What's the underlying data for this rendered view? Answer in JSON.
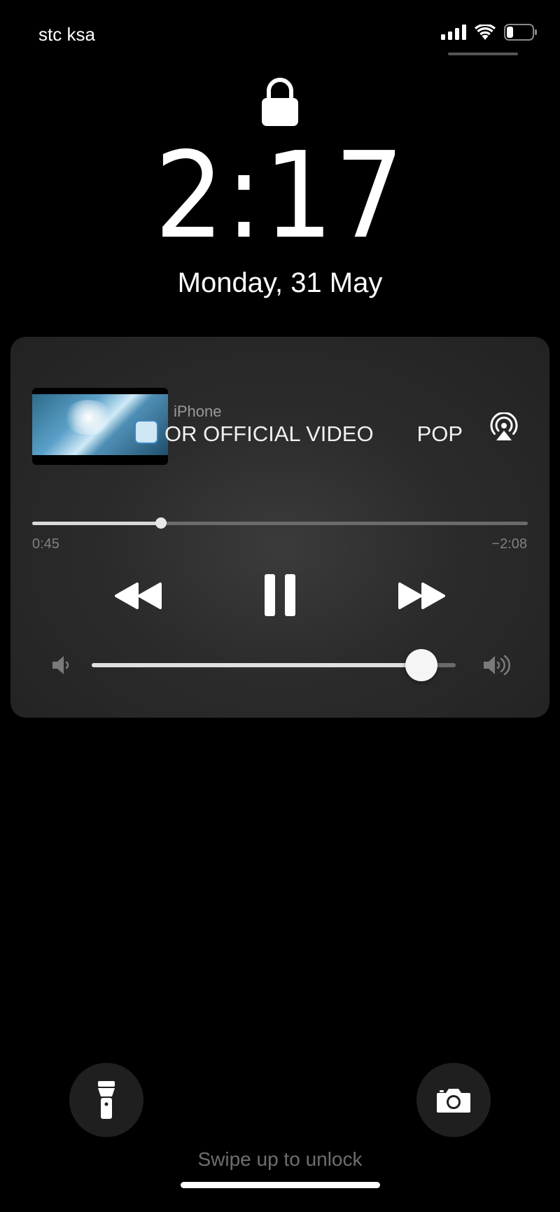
{
  "status_bar": {
    "carrier": "stc ksa",
    "icons": [
      "cellular-signal-icon",
      "wifi-icon",
      "battery-icon"
    ]
  },
  "lock_screen": {
    "lock_icon": "padlock-icon",
    "time": "2:17",
    "date": "Monday, 31 May"
  },
  "now_playing": {
    "source": "iPhone",
    "title_fragment_1": "OR OFFICIAL VIDEO",
    "title_fragment_2": "POP",
    "elapsed": "0:45",
    "remaining": "−2:08",
    "progress_fraction": 0.26,
    "volume_fraction": 0.905,
    "controls": [
      "rewind-icon",
      "pause-icon",
      "fast-forward-icon"
    ],
    "airplay_icon": "airplay-audio-icon",
    "volume_icons": [
      "volume-low-icon",
      "volume-high-icon"
    ]
  },
  "quick_actions": {
    "left": "flashlight-icon",
    "right": "camera-icon"
  },
  "footer": {
    "swipe_hint": "Swipe up to unlock"
  },
  "colors": {
    "background": "#000000",
    "card": "#2b2b2b",
    "text_primary": "#ffffff",
    "text_secondary": "#9a9a9a"
  }
}
